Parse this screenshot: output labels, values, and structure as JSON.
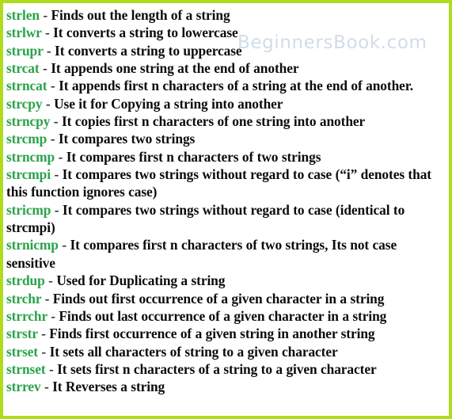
{
  "page": {
    "background_color": "#ffffff",
    "border_color": "#aedc1e",
    "function_name_color": "#2aa34a",
    "description_color": "#0c0c0c",
    "separator": "-"
  },
  "watermark": {
    "text": "BeginnersBook.com",
    "color": "#c9d8e6"
  },
  "entries": [
    {
      "name": "strlen",
      "sep": "-",
      "description": "Finds out the length of a string"
    },
    {
      "name": "strlwr",
      "sep": "-",
      "description": "It converts a string to lowercase"
    },
    {
      "name": "strupr",
      "sep": "-",
      "description": "It converts a string to uppercase"
    },
    {
      "name": "strcat",
      "sep": "-",
      "description": "It appends one string at the end of another"
    },
    {
      "name": "strncat",
      "sep": "-",
      "description": "It appends first n characters of a string at the end of another."
    },
    {
      "name": "strcpy",
      "sep": "-",
      "description": "Use it for Copying a string into another"
    },
    {
      "name": "strncpy",
      "sep": "-",
      "description": "It copies first n characters of one string into another"
    },
    {
      "name": "strcmp",
      "sep": "-",
      "description": "It compares two strings"
    },
    {
      "name": "strncmp",
      "sep": "-",
      "description": "It compares first n characters of two strings"
    },
    {
      "name": "strcmpi",
      "sep": "-",
      "description": "It compares two strings without regard to case (“i” denotes that this function ignores case)"
    },
    {
      "name": "stricmp",
      "sep": "-",
      "description": "It compares two strings without regard to case (identical to strcmpi)"
    },
    {
      "name": "strnicmp",
      "sep": "-",
      "description": "It compares first n characters of two strings, Its not case sensitive"
    },
    {
      "name": "strdup",
      "sep": "-",
      "description": "Used for Duplicating a string"
    },
    {
      "name": "strchr",
      "sep": "-",
      "description": "Finds out first occurrence of a given character in a string"
    },
    {
      "name": "strrchr",
      "sep": "-",
      "description": "Finds out last occurrence of a given character in a string"
    },
    {
      "name": "strstr",
      "sep": "-",
      "description": "Finds first occurrence of a given string in another string"
    },
    {
      "name": "strset",
      "sep": "-",
      "description": "It sets all characters of string to a given character"
    },
    {
      "name": "strnset",
      "sep": "-",
      "description": "It sets first n characters of a string to a given character"
    },
    {
      "name": "strrev",
      "sep": "-",
      "description": "It Reverses a string"
    }
  ]
}
